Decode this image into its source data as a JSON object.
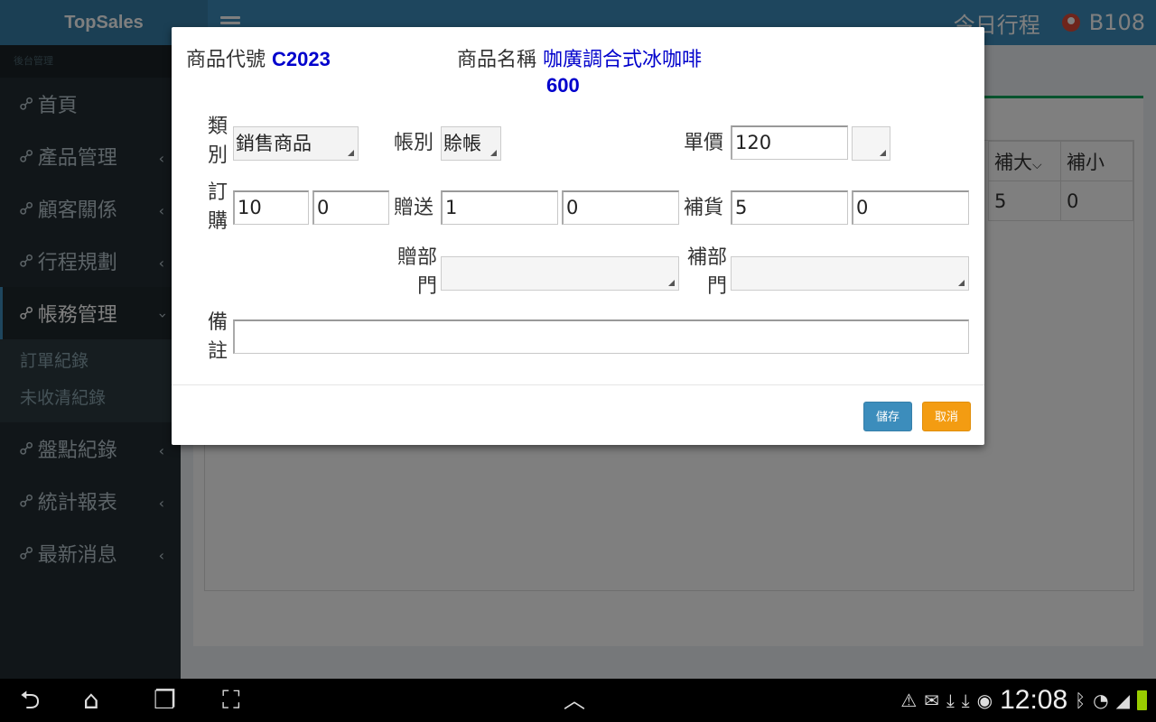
{
  "app": {
    "logo": "TopSales",
    "top_right_link": "今日行程",
    "user_code": "B108"
  },
  "sidebar": {
    "header": "後台管理",
    "items": [
      {
        "label": "首頁",
        "icon": "link-icon",
        "chevron": false
      },
      {
        "label": "產品管理",
        "icon": "link-icon",
        "chevron": true
      },
      {
        "label": "顧客關係",
        "icon": "link-icon",
        "chevron": true
      },
      {
        "label": "行程規劃",
        "icon": "link-icon",
        "chevron": true
      },
      {
        "label": "帳務管理",
        "icon": "link-icon",
        "chevron": true,
        "active": true
      },
      {
        "label": "盤點紀錄",
        "icon": "link-icon",
        "chevron": true
      },
      {
        "label": "統計報表",
        "icon": "link-icon",
        "chevron": true
      },
      {
        "label": "最新消息",
        "icon": "link-icon",
        "chevron": true
      }
    ],
    "submenu": [
      "訂單紀錄",
      "未收清紀錄"
    ]
  },
  "background_table": {
    "headers": [
      "補大",
      "補小"
    ],
    "row": [
      "5",
      "0"
    ]
  },
  "modal": {
    "code_label": "商品代號",
    "code_value": "C2023",
    "name_label": "商品名稱",
    "name_value": "咖廣調合式冰咖啡",
    "price_total": "600",
    "category_label": "類別",
    "category_value": "銷售商品",
    "account_label": "帳別",
    "account_value": "賒帳",
    "unit_price_label": "單價",
    "unit_price_value": "120",
    "unit_price_select": "",
    "order_label": "訂購",
    "order_big": "10",
    "order_small": "0",
    "gift_label": "贈送",
    "gift_big": "1",
    "gift_small": "0",
    "restock_label": "補貨",
    "restock_big": "5",
    "restock_small": "0",
    "gift_dept_label": "贈部門",
    "gift_dept_value": "",
    "restock_dept_label": "補部門",
    "restock_dept_value": "",
    "remark_label": "備註",
    "remark_value": "",
    "save_button": "儲存",
    "cancel_button": "取消"
  },
  "android_bar": {
    "clock": "12:08"
  },
  "colors": {
    "topbar": "#3c8dbc",
    "sidebar": "#222d32",
    "save": "#3c8dbc",
    "cancel": "#f39c12",
    "value_blue": "#0000cc"
  }
}
